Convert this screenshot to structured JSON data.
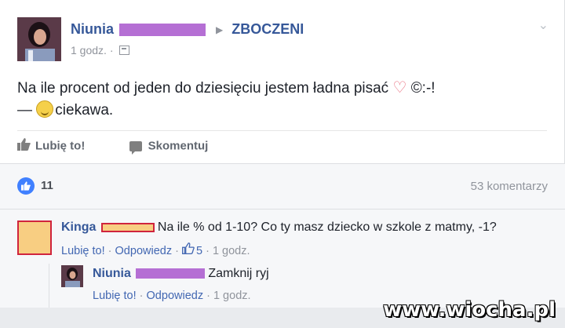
{
  "post": {
    "author": "Niunia",
    "group": "ZBOCZENI",
    "time": "1 godz. ·",
    "text_line1": "Na ile procent od jeden do dziesięciu jestem ładna pisać",
    "text_line1_tail": "©:-!",
    "text_line2_prefix": "—",
    "text_line2": "ciekawa.",
    "like_label": "Lubię to!",
    "comment_label": "Skomentuj"
  },
  "summary": {
    "likes": "11",
    "comments": "53 komentarzy"
  },
  "comments": [
    {
      "author": "Kinga",
      "text": "Na ile % od 1-10? Co ty masz dziecko w szkole z matmy, -1?",
      "like_label": "Lubię to!",
      "sep1": " · ",
      "reply_label": "Odpowiedz",
      "sep2": " · ",
      "reactions": "5",
      "sep3": " · ",
      "time": "1 godz."
    },
    {
      "author": "Niunia",
      "text": "Zamknij ryj",
      "like_label": "Lubię to!",
      "sep1": " · ",
      "reply_label": "Odpowiedz",
      "sep2": " · ",
      "time": "1 godz."
    }
  ],
  "watermark": "www.wiocha.pl",
  "colors": {
    "link_blue": "#365899",
    "action_blue": "#4267b2",
    "redaction_purple": "#b56fd4",
    "redaction_red_border": "#d0243d",
    "redaction_fill": "#f8ce82"
  },
  "icons": [
    "chevron-down-icon",
    "privacy-icon",
    "heart-icon",
    "emoji-icon",
    "like-icon",
    "comment-icon",
    "like-badge-icon",
    "thumbs-up-icon"
  ]
}
